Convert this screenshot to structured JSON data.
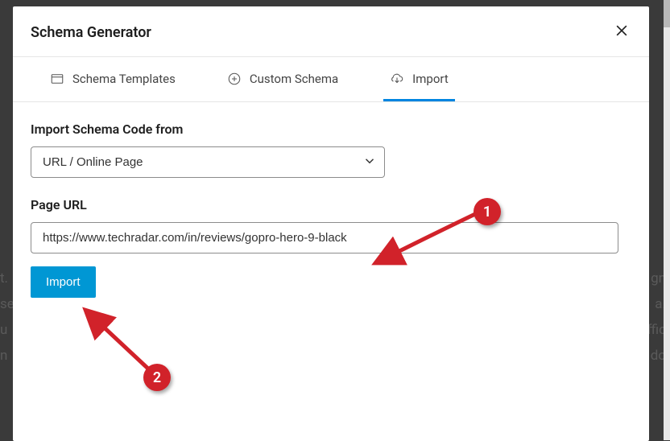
{
  "modal": {
    "title": "Schema Generator"
  },
  "tabs": {
    "templates": "Schema Templates",
    "custom": "Custom Schema",
    "import": "Import"
  },
  "form": {
    "source_label": "Import Schema Code from",
    "source_value": "URL / Online Page",
    "url_label": "Page URL",
    "url_value": "https://www.techradar.com/in/reviews/gopro-hero-9-black",
    "import_btn": "Import"
  },
  "annotations": {
    "marker1": "1",
    "marker2": "2"
  },
  "backdrop": {
    "l1": "t.",
    "l2": "se",
    "l3": "u",
    "l4": "n",
    "r1": "gn",
    "r2": "a.",
    "r3": "ffic",
    "r4": "do"
  }
}
